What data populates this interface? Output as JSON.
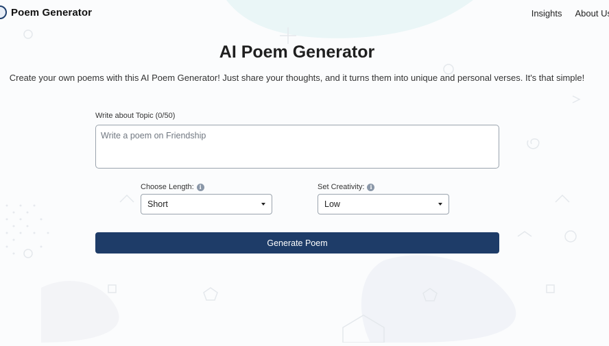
{
  "header": {
    "brand_name": "Poem Generator",
    "nav": [
      "Insights",
      "About Us"
    ]
  },
  "main": {
    "title": "AI Poem Generator",
    "subtitle": "Create your own poems with this AI Poem Generator! Just share your thoughts, and it turns them into unique and personal verses. It's that simple!"
  },
  "form": {
    "topic_label": "Write about Topic (0/50)",
    "topic_placeholder": "Write a poem on Friendship",
    "topic_value": "",
    "length_label": "Choose Length:",
    "length_value": "Short",
    "creativity_label": "Set Creativity:",
    "creativity_value": "Low",
    "generate_label": "Generate Poem"
  },
  "colors": {
    "accent": "#1e3c68",
    "info_icon": "#8a97a8"
  },
  "icons": [
    "logo-icon",
    "info-icon",
    "chevron-down-icon"
  ]
}
